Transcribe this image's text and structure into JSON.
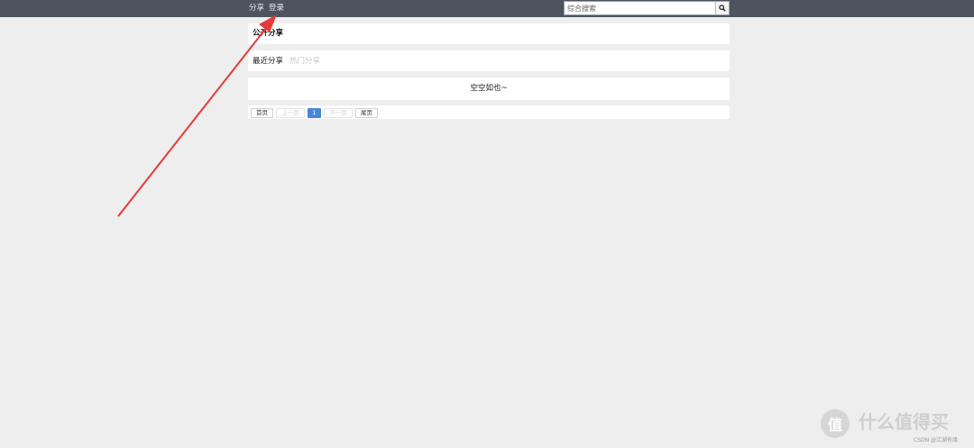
{
  "topbar": {
    "nav": [
      {
        "label": "分享"
      },
      {
        "label": "登录"
      }
    ],
    "search": {
      "placeholder": "综合搜索",
      "icon": "search-icon"
    }
  },
  "main": {
    "section_title": "公开分享",
    "tabs": [
      {
        "label": "最近分享",
        "active": true
      },
      {
        "label": "热门分享",
        "active": false
      }
    ],
    "empty_message": "空空如也~",
    "pagination": {
      "first": "首页",
      "prev": "上一页",
      "current": "1",
      "next": "下一页",
      "last": "尾页"
    }
  },
  "watermark": {
    "logo_glyph": "值",
    "brand": "什么值得买",
    "credit": "CSDN @江湖有缘"
  },
  "colors": {
    "topbar": "#4d5460",
    "background": "#eeeeee",
    "accent": "#4a86d8",
    "annotation_arrow": "#e63a3a"
  }
}
